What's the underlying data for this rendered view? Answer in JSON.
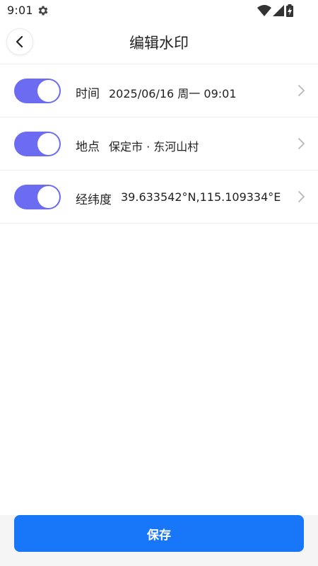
{
  "status_bar": {
    "time": "9:01",
    "icons": [
      "settings-gear-icon",
      "wifi-icon",
      "cell-signal-icon",
      "battery-charging-icon"
    ]
  },
  "header": {
    "title": "编辑水印",
    "back_icon": "chevron-left-icon"
  },
  "rows": [
    {
      "label": "时间",
      "value": "2025/06/16 周一 09:01",
      "enabled": true
    },
    {
      "label": "地点",
      "value": "保定市 · 东河山村",
      "enabled": true
    },
    {
      "label": "经纬度",
      "value": "39.633542°N,115.109334°E",
      "enabled": true
    }
  ],
  "footer": {
    "save_label": "保存"
  },
  "colors": {
    "toggle_on": "#6c6cf2",
    "primary": "#1877f8",
    "chevron": "#b8b8b8"
  }
}
